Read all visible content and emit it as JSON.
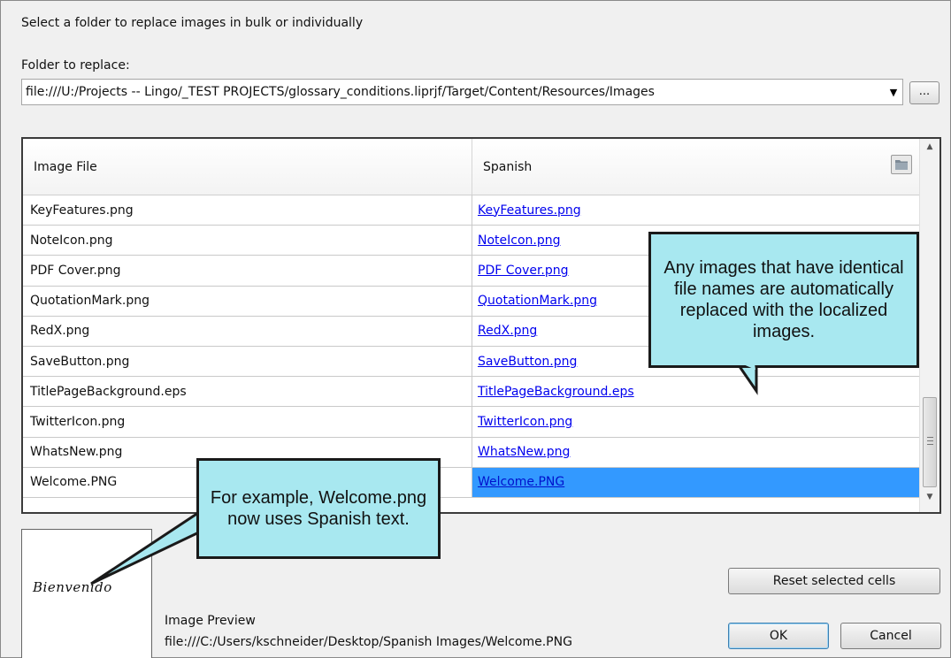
{
  "dialog": {
    "instruction": "Select a folder to replace images in bulk or individually",
    "folder_label": "Folder to replace:",
    "folder_value": "file:///U:/Projects -- Lingo/_TEST PROJECTS/glossary_conditions.liprjf/Target/Content/Resources/Images",
    "browse_label": "..."
  },
  "grid": {
    "columns": [
      "Image File",
      "Spanish"
    ],
    "rows": [
      {
        "file": "KeyFeatures.png",
        "spanish": "KeyFeatures.png"
      },
      {
        "file": "NoteIcon.png",
        "spanish": "NoteIcon.png"
      },
      {
        "file": "PDF Cover.png",
        "spanish": "PDF Cover.png"
      },
      {
        "file": "QuotationMark.png",
        "spanish": "QuotationMark.png"
      },
      {
        "file": "RedX.png",
        "spanish": "RedX.png"
      },
      {
        "file": "SaveButton.png",
        "spanish": "SaveButton.png"
      },
      {
        "file": "TitlePageBackground.eps",
        "spanish": "TitlePageBackground.eps"
      },
      {
        "file": "TwitterIcon.png",
        "spanish": "TwitterIcon.png"
      },
      {
        "file": "WhatsNew.png",
        "spanish": "WhatsNew.png"
      },
      {
        "file": "Welcome.PNG",
        "spanish": "Welcome.PNG",
        "selected": true
      }
    ]
  },
  "preview": {
    "image_text": "Bienvenido",
    "label": "Image Preview",
    "path": "file:///C:/Users/kschneider/Desktop/Spanish Images/Welcome.PNG"
  },
  "buttons": {
    "reset": "Reset selected cells",
    "ok": "OK",
    "cancel": "Cancel"
  },
  "callouts": {
    "identical": "Any images that have identical file names are automatically replaced with the localized images.",
    "example": "For example, Welcome.png now uses Spanish text."
  },
  "colors": {
    "callout_fill": "#a8e8f0",
    "selection": "#3399ff",
    "link": "#0000ee"
  },
  "icons": [
    "dropdown-arrow-icon",
    "folder-icon",
    "scroll-up-icon",
    "scroll-down-icon"
  ]
}
